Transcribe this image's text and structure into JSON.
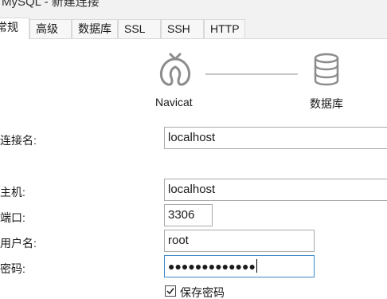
{
  "window": {
    "title": "MySQL - 新建连接"
  },
  "tabs": [
    {
      "label": "常规",
      "active": true
    },
    {
      "label": "高级",
      "active": false
    },
    {
      "label": "数据库",
      "active": false
    },
    {
      "label": "SSL",
      "active": false
    },
    {
      "label": "SSH",
      "active": false
    },
    {
      "label": "HTTP",
      "active": false
    }
  ],
  "diagram": {
    "left_caption": "Navicat",
    "right_caption": "数据库",
    "left_icon": "navicat-logo-icon",
    "right_icon": "database-icon"
  },
  "form": {
    "connection_name": {
      "label": "连接名:",
      "value": "localhost"
    },
    "host": {
      "label": "主机:",
      "value": "localhost"
    },
    "port": {
      "label": "端口:",
      "value": "3306"
    },
    "username": {
      "label": "用户名:",
      "value": "root"
    },
    "password": {
      "label": "密码:",
      "value": "●●●●●●●●●●●●●"
    },
    "save_password": {
      "label": "保存密码",
      "checked": true
    }
  },
  "colors": {
    "icon_gray": "#8c8c8c",
    "focus_border": "#3a86c8",
    "field_border": "#a9a9a9",
    "chrome_bg": "#f2f2f2"
  }
}
